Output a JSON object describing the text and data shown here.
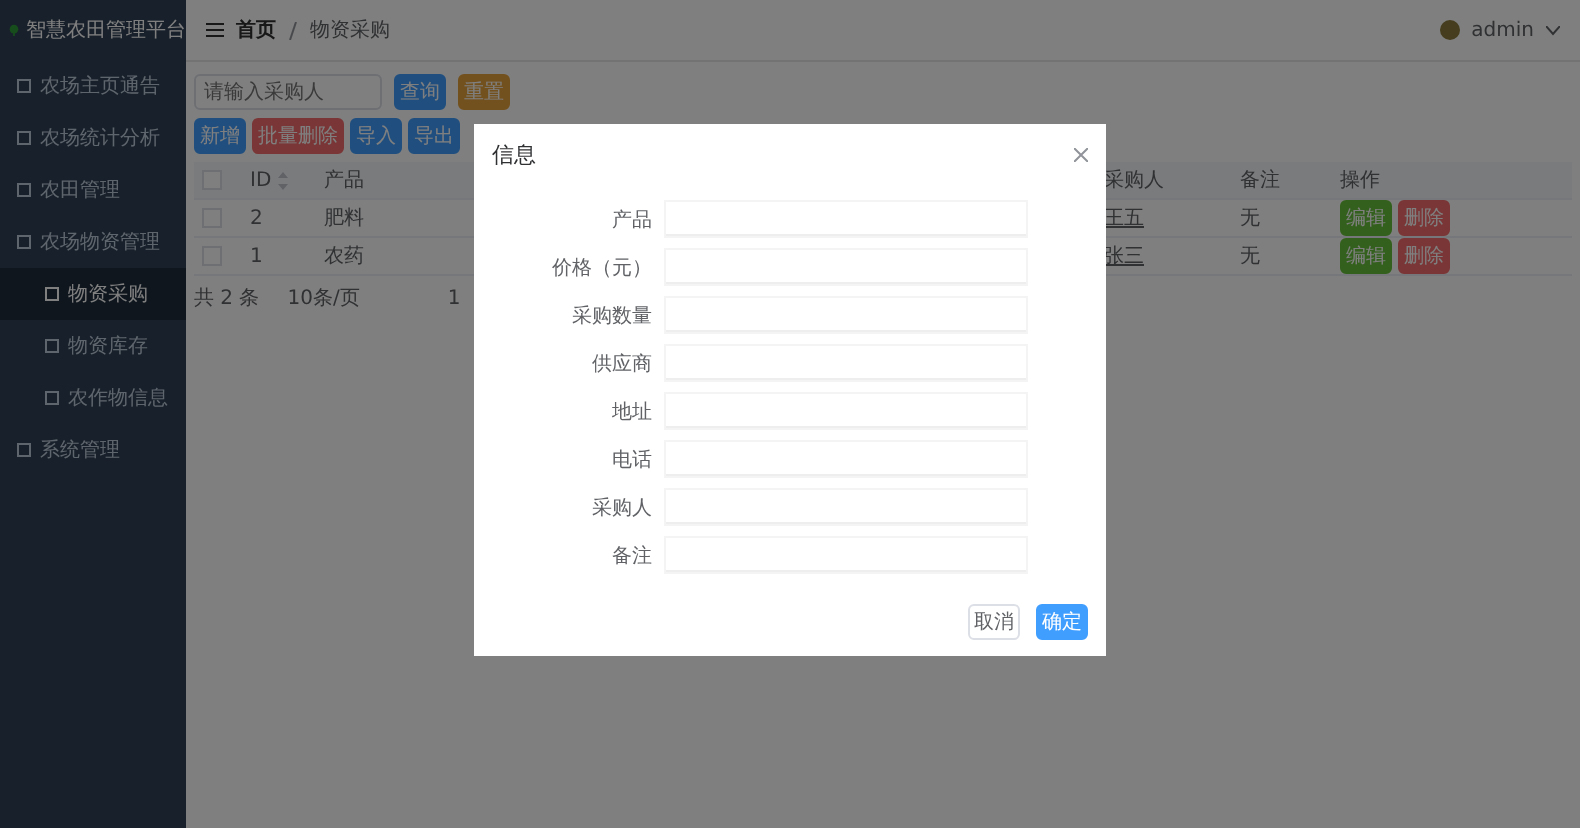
{
  "sidebar": {
    "logo": "智慧农田管理平台",
    "items": [
      {
        "label": "农场主页通告",
        "selected": false
      },
      {
        "label": "农场统计分析",
        "selected": false
      },
      {
        "label": "农田管理",
        "selected": false
      },
      {
        "label": "农场物资管理",
        "selected": false,
        "children": [
          {
            "label": "物资采购",
            "selected": true
          },
          {
            "label": "物资库存",
            "selected": false
          },
          {
            "label": "农作物信息",
            "selected": false
          }
        ]
      },
      {
        "label": "系统管理",
        "selected": false
      }
    ]
  },
  "header": {
    "breadcrumb": [
      "首页",
      "物资采购"
    ],
    "user": "admin"
  },
  "search": {
    "placeholder": "请输入采购人",
    "buttons": [
      {
        "label": "查询",
        "kind": "primary"
      },
      {
        "label": "重置",
        "kind": "warning"
      }
    ]
  },
  "toolbar": [
    {
      "label": "新增",
      "kind": "primary"
    },
    {
      "label": "批量删除",
      "kind": "danger"
    },
    {
      "label": "导入",
      "kind": "primary"
    },
    {
      "label": "导出",
      "kind": "primary"
    }
  ],
  "table": {
    "columns": [
      "ID",
      "产品",
      "采购人",
      "备注",
      "操作"
    ],
    "all_checked": false,
    "rows": [
      {
        "checked": false,
        "id": "2",
        "product": "肥料",
        "buyer": "王五",
        "note": "无",
        "actions": [
          "编辑",
          "删除"
        ]
      },
      {
        "checked": false,
        "id": "1",
        "product": "农药",
        "buyer": "张三",
        "note": "无",
        "actions": [
          "编辑",
          "删除"
        ]
      }
    ]
  },
  "pagination": {
    "total": "共 2 条",
    "size": "10条/页",
    "page": "1"
  },
  "dialog": {
    "title": "信息",
    "fields": [
      "产品",
      "价格（元）",
      "采购数量",
      "供应商",
      "地址",
      "电话",
      "采购人",
      "备注"
    ],
    "buttons": [
      {
        "label": "取消",
        "kind": "default"
      },
      {
        "label": "确定",
        "kind": "primary"
      }
    ]
  }
}
